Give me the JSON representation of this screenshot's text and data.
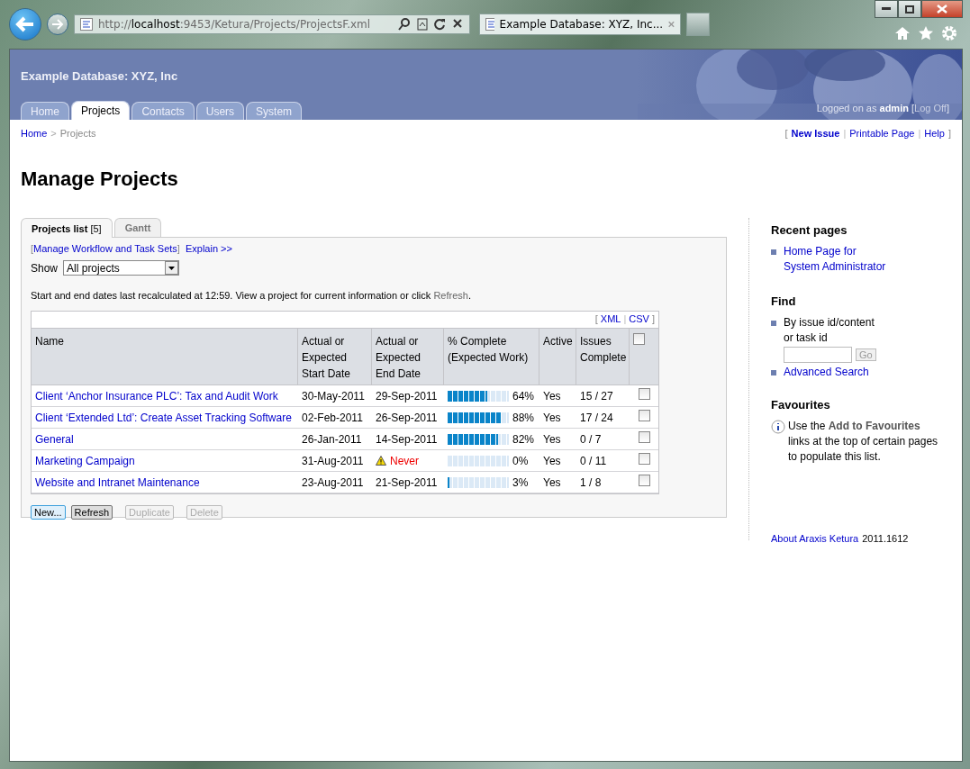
{
  "browser": {
    "address": {
      "scheme": "http://",
      "host": "localhost",
      "path": ":9453/Ketura/Projects/ProjectsF.xml"
    },
    "tab_title": "Example Database: XYZ, Inc..."
  },
  "header": {
    "site_title": "Example Database: XYZ, Inc",
    "nav_tabs": [
      {
        "label": "Home",
        "selected": false
      },
      {
        "label": "Projects",
        "selected": true
      },
      {
        "label": "Contacts",
        "selected": false
      },
      {
        "label": "Users",
        "selected": false
      },
      {
        "label": "System",
        "selected": false
      }
    ],
    "login": {
      "text": "Logged on as **admin** [",
      "link": "Log Off",
      "after": "]"
    }
  },
  "breadcrumb": {
    "items": [
      "Home",
      "Projects"
    ],
    "separator": ">"
  },
  "page_links": {
    "open": "[",
    "close": "]",
    "separator": "|",
    "items": [
      {
        "label": "New Issue",
        "bold": true
      },
      {
        "label": "Printable Page",
        "bold": false
      },
      {
        "label": "Help",
        "bold": false
      }
    ]
  },
  "heading": "Manage Projects",
  "content_tabs": [
    {
      "label": "Projects list",
      "count": "[5]",
      "selected": true
    },
    {
      "label": "Gantt",
      "selected": false
    }
  ],
  "panel": {
    "workflow": {
      "open": "[",
      "link": "Manage Workflow and Task Sets",
      "close": "]"
    },
    "explain": "Explain >>",
    "show": {
      "label": "Show",
      "value": "All projects"
    },
    "info": {
      "text": "Start and end dates last recalculated at 12:59. View a project for current information or click",
      "link": "Refresh",
      "after": "."
    },
    "table": {
      "exports": {
        "open": "[",
        "items": [
          "XML",
          "CSV"
        ],
        "separator": "|",
        "close": "]"
      },
      "columns": [
        "Name",
        "Actual or Expected Start Date",
        "Actual or Expected End Date",
        "% Complete (Expected Work)",
        "Active",
        "Issues Complete"
      ],
      "select_all": {
        "checked": false
      },
      "rows": [
        {
          "name": "Client ‘Anchor Insurance PLC’: Tax and Audit Work",
          "start": "30-May-2011",
          "end": "29-Sep-2011",
          "warning": false,
          "level": 0.64,
          "percent": "64%",
          "active": "Yes",
          "issues": "15 / 27",
          "checked": false
        },
        {
          "name": "Client ‘Extended Ltd’: Create Asset Tracking Software",
          "start": "02-Feb-2011",
          "end": "26-Sep-2011",
          "warning": false,
          "level": 0.88,
          "percent": "88%",
          "active": "Yes",
          "issues": "17 / 24",
          "checked": false
        },
        {
          "name": "General",
          "start": "26-Jan-2011",
          "end": "14-Sep-2011",
          "warning": false,
          "level": 0.82,
          "percent": "82%",
          "active": "Yes",
          "issues": "0 / 7",
          "checked": false
        },
        {
          "name": "Marketing Campaign",
          "start": "31-Aug-2011",
          "end": "Never",
          "warning": true,
          "level": 0,
          "percent": "0%",
          "active": "Yes",
          "issues": "0 / 11",
          "checked": false
        },
        {
          "name": "Website and Intranet Maintenance",
          "start": "23-Aug-2011",
          "end": "21-Sep-2011",
          "warning": false,
          "level": 0.03,
          "percent": "3%",
          "active": "Yes",
          "issues": "1 / 8",
          "checked": false
        }
      ]
    },
    "buttons": [
      {
        "label": "New...",
        "focused": true,
        "disabled": false
      },
      {
        "label": "Refresh",
        "focused": false,
        "disabled": false
      },
      {
        "label": "Duplicate",
        "focused": false,
        "disabled": true
      },
      {
        "label": "Delete",
        "focused": false,
        "disabled": true
      }
    ]
  },
  "sidebar": {
    "recent": {
      "title": "Recent pages",
      "items": [
        "Home Page for System Administrator"
      ]
    },
    "find": {
      "title": "Find",
      "label": "By issue id/content or task id",
      "go": "Go",
      "advanced": "Advanced Search"
    },
    "favourites": {
      "title": "Favourites",
      "text": "Use the **Add to Favourites** links at the top of certain pages to populate this list."
    },
    "about": {
      "link": "About Araxis Ketura",
      "version": "2011.1612"
    }
  }
}
